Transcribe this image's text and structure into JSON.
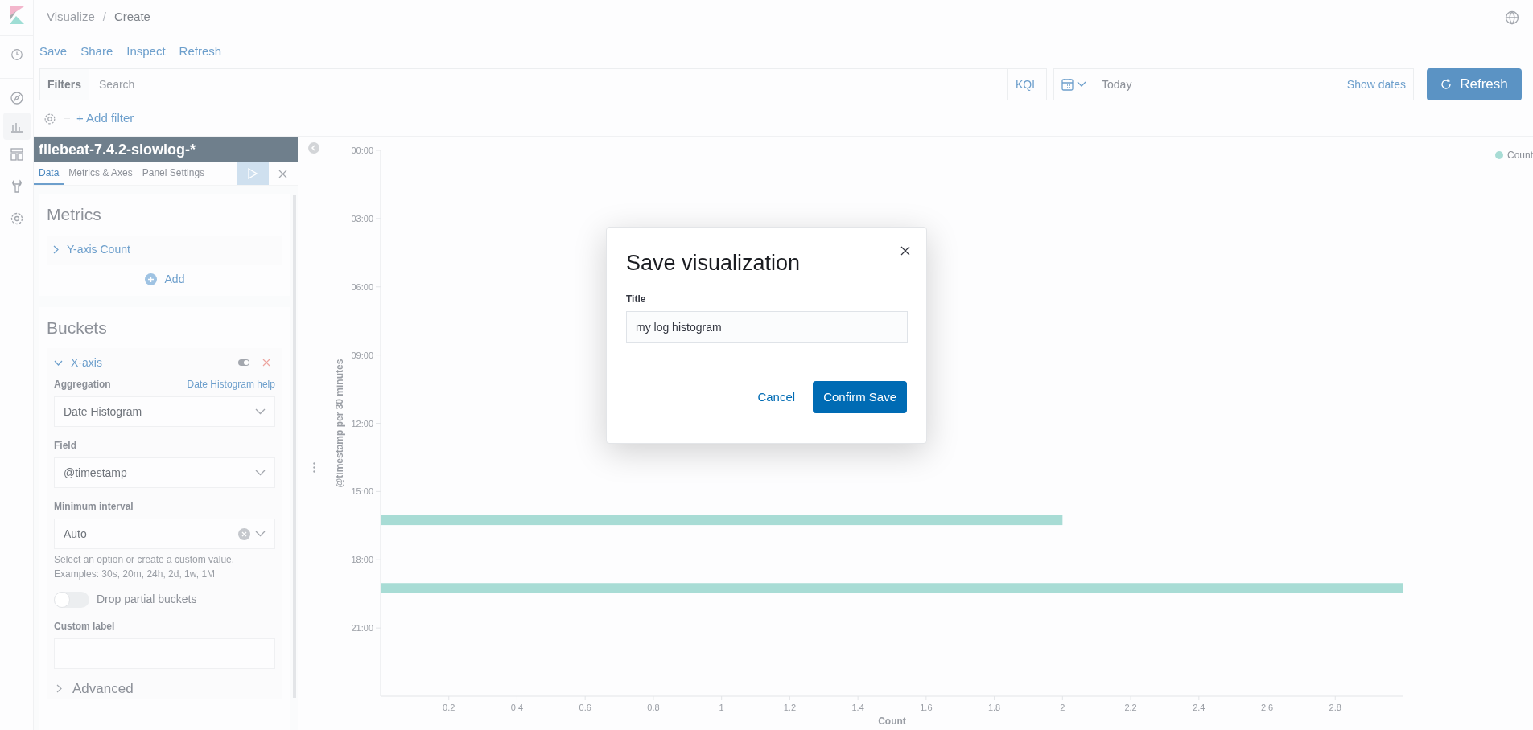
{
  "breadcrumbs": [
    "Visualize",
    "Create"
  ],
  "breadcrumb_separator": "/",
  "top_menu": [
    "Save",
    "Share",
    "Inspect",
    "Refresh"
  ],
  "query_bar": {
    "filters_label": "Filters",
    "search_placeholder": "Search",
    "language": "KQL",
    "date": "Today",
    "show_dates": "Show dates",
    "refresh": "Refresh"
  },
  "filter_bar": {
    "add_filter": "+ Add filter"
  },
  "editor": {
    "index_pattern": "filebeat-7.4.2-slowlog-*",
    "tabs": [
      {
        "label": "Data",
        "selected": true
      },
      {
        "label": "Metrics & Axes",
        "selected": false
      },
      {
        "label": "Panel Settings",
        "selected": false
      }
    ],
    "metrics": {
      "title": "Metrics",
      "item": "Y-axis Count",
      "add": "Add"
    },
    "buckets": {
      "title": "Buckets",
      "item": "X-axis",
      "enabled": true,
      "aggregation": {
        "label": "Aggregation",
        "help": "Date Histogram help",
        "value": "Date Histogram"
      },
      "field": {
        "label": "Field",
        "value": "@timestamp"
      },
      "interval": {
        "label": "Minimum interval",
        "value": "Auto",
        "help": [
          "Select an option or create a custom value.",
          "Examples: 30s, 20m, 24h, 2d, 1w, 1M"
        ]
      },
      "drop_partial": {
        "label": "Drop partial buckets",
        "on": false
      },
      "custom_label": {
        "label": "Custom label"
      },
      "advanced": "Advanced"
    }
  },
  "chart": {
    "chart_data": {
      "type": "bar",
      "orientation": "horizontal",
      "xlabel": "Count",
      "ylabel": "@timestamp per 30 minutes",
      "x": [
        16,
        19
      ],
      "series": [
        {
          "name": "Count",
          "color": "#a8dcd5",
          "values": [
            2,
            3
          ]
        }
      ],
      "xlim": [
        0,
        3
      ],
      "ylim": [
        24,
        0
      ],
      "yticks": [
        {
          "value": 0,
          "label": "00:00"
        },
        {
          "value": 3,
          "label": "03:00"
        },
        {
          "value": 6,
          "label": "06:00"
        },
        {
          "value": 9,
          "label": "09:00"
        },
        {
          "value": 12,
          "label": "12:00"
        },
        {
          "value": 15,
          "label": "15:00"
        },
        {
          "value": 18,
          "label": "18:00"
        },
        {
          "value": 21,
          "label": "21:00"
        }
      ],
      "xticks": [
        {
          "value": 0.2,
          "label": "0.2"
        },
        {
          "value": 0.4,
          "label": "0.4"
        },
        {
          "value": 0.6,
          "label": "0.6"
        },
        {
          "value": 0.8,
          "label": "0.8"
        },
        {
          "value": 1,
          "label": "1"
        },
        {
          "value": 1.2,
          "label": "1.2"
        },
        {
          "value": 1.4,
          "label": "1.4"
        },
        {
          "value": 1.6,
          "label": "1.6"
        },
        {
          "value": 1.8,
          "label": "1.8"
        },
        {
          "value": 2,
          "label": "2"
        },
        {
          "value": 2.2,
          "label": "2.2"
        },
        {
          "value": 2.4,
          "label": "2.4"
        },
        {
          "value": 2.6,
          "label": "2.6"
        },
        {
          "value": 2.8,
          "label": "2.8"
        }
      ]
    }
  },
  "modal": {
    "title": "Save visualization",
    "field_label": "Title",
    "value": "my log histogram",
    "cancel": "Cancel",
    "confirm": "Confirm Save"
  }
}
